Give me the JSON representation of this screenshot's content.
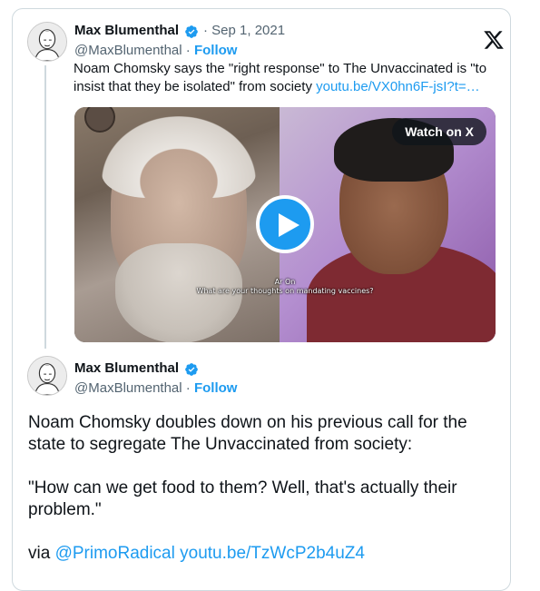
{
  "quoted_tweet": {
    "author_name": "Max Blumenthal",
    "date": "· Sep 1, 2021",
    "handle": "@MaxBlumenthal",
    "separator": "·",
    "follow_label": "Follow",
    "text": "Noam Chomsky says the \"right response\" to The Unvaccinated is \"to insist that they be isolated\" from society",
    "link": "youtu.be/VX0hn6F-jsI?t=…",
    "media": {
      "watch_label": "Watch on X",
      "caption_speaker": "Ar On",
      "caption_text": "What are your thoughts on mandating vaccines?"
    }
  },
  "main_tweet": {
    "author_name": "Max Blumenthal",
    "handle": "@MaxBlumenthal",
    "separator": "·",
    "follow_label": "Follow",
    "paragraph1": "Noam Chomsky doubles down on his previous call for the state to segregate The Unvaccinated from society:",
    "paragraph2": "\"How can we get food to them? Well, that's actually their problem.\"",
    "via_label": "via",
    "mention": "@PrimoRadical",
    "link": "youtu.be/TzWcP2b4uZ4"
  },
  "colors": {
    "accent": "#1d9bf0",
    "text": "#0f1419",
    "muted": "#536471",
    "border": "#cfd9de"
  },
  "icons": {
    "verified": "verified-badge-icon",
    "logo": "x-logo-icon",
    "play": "play-icon"
  }
}
